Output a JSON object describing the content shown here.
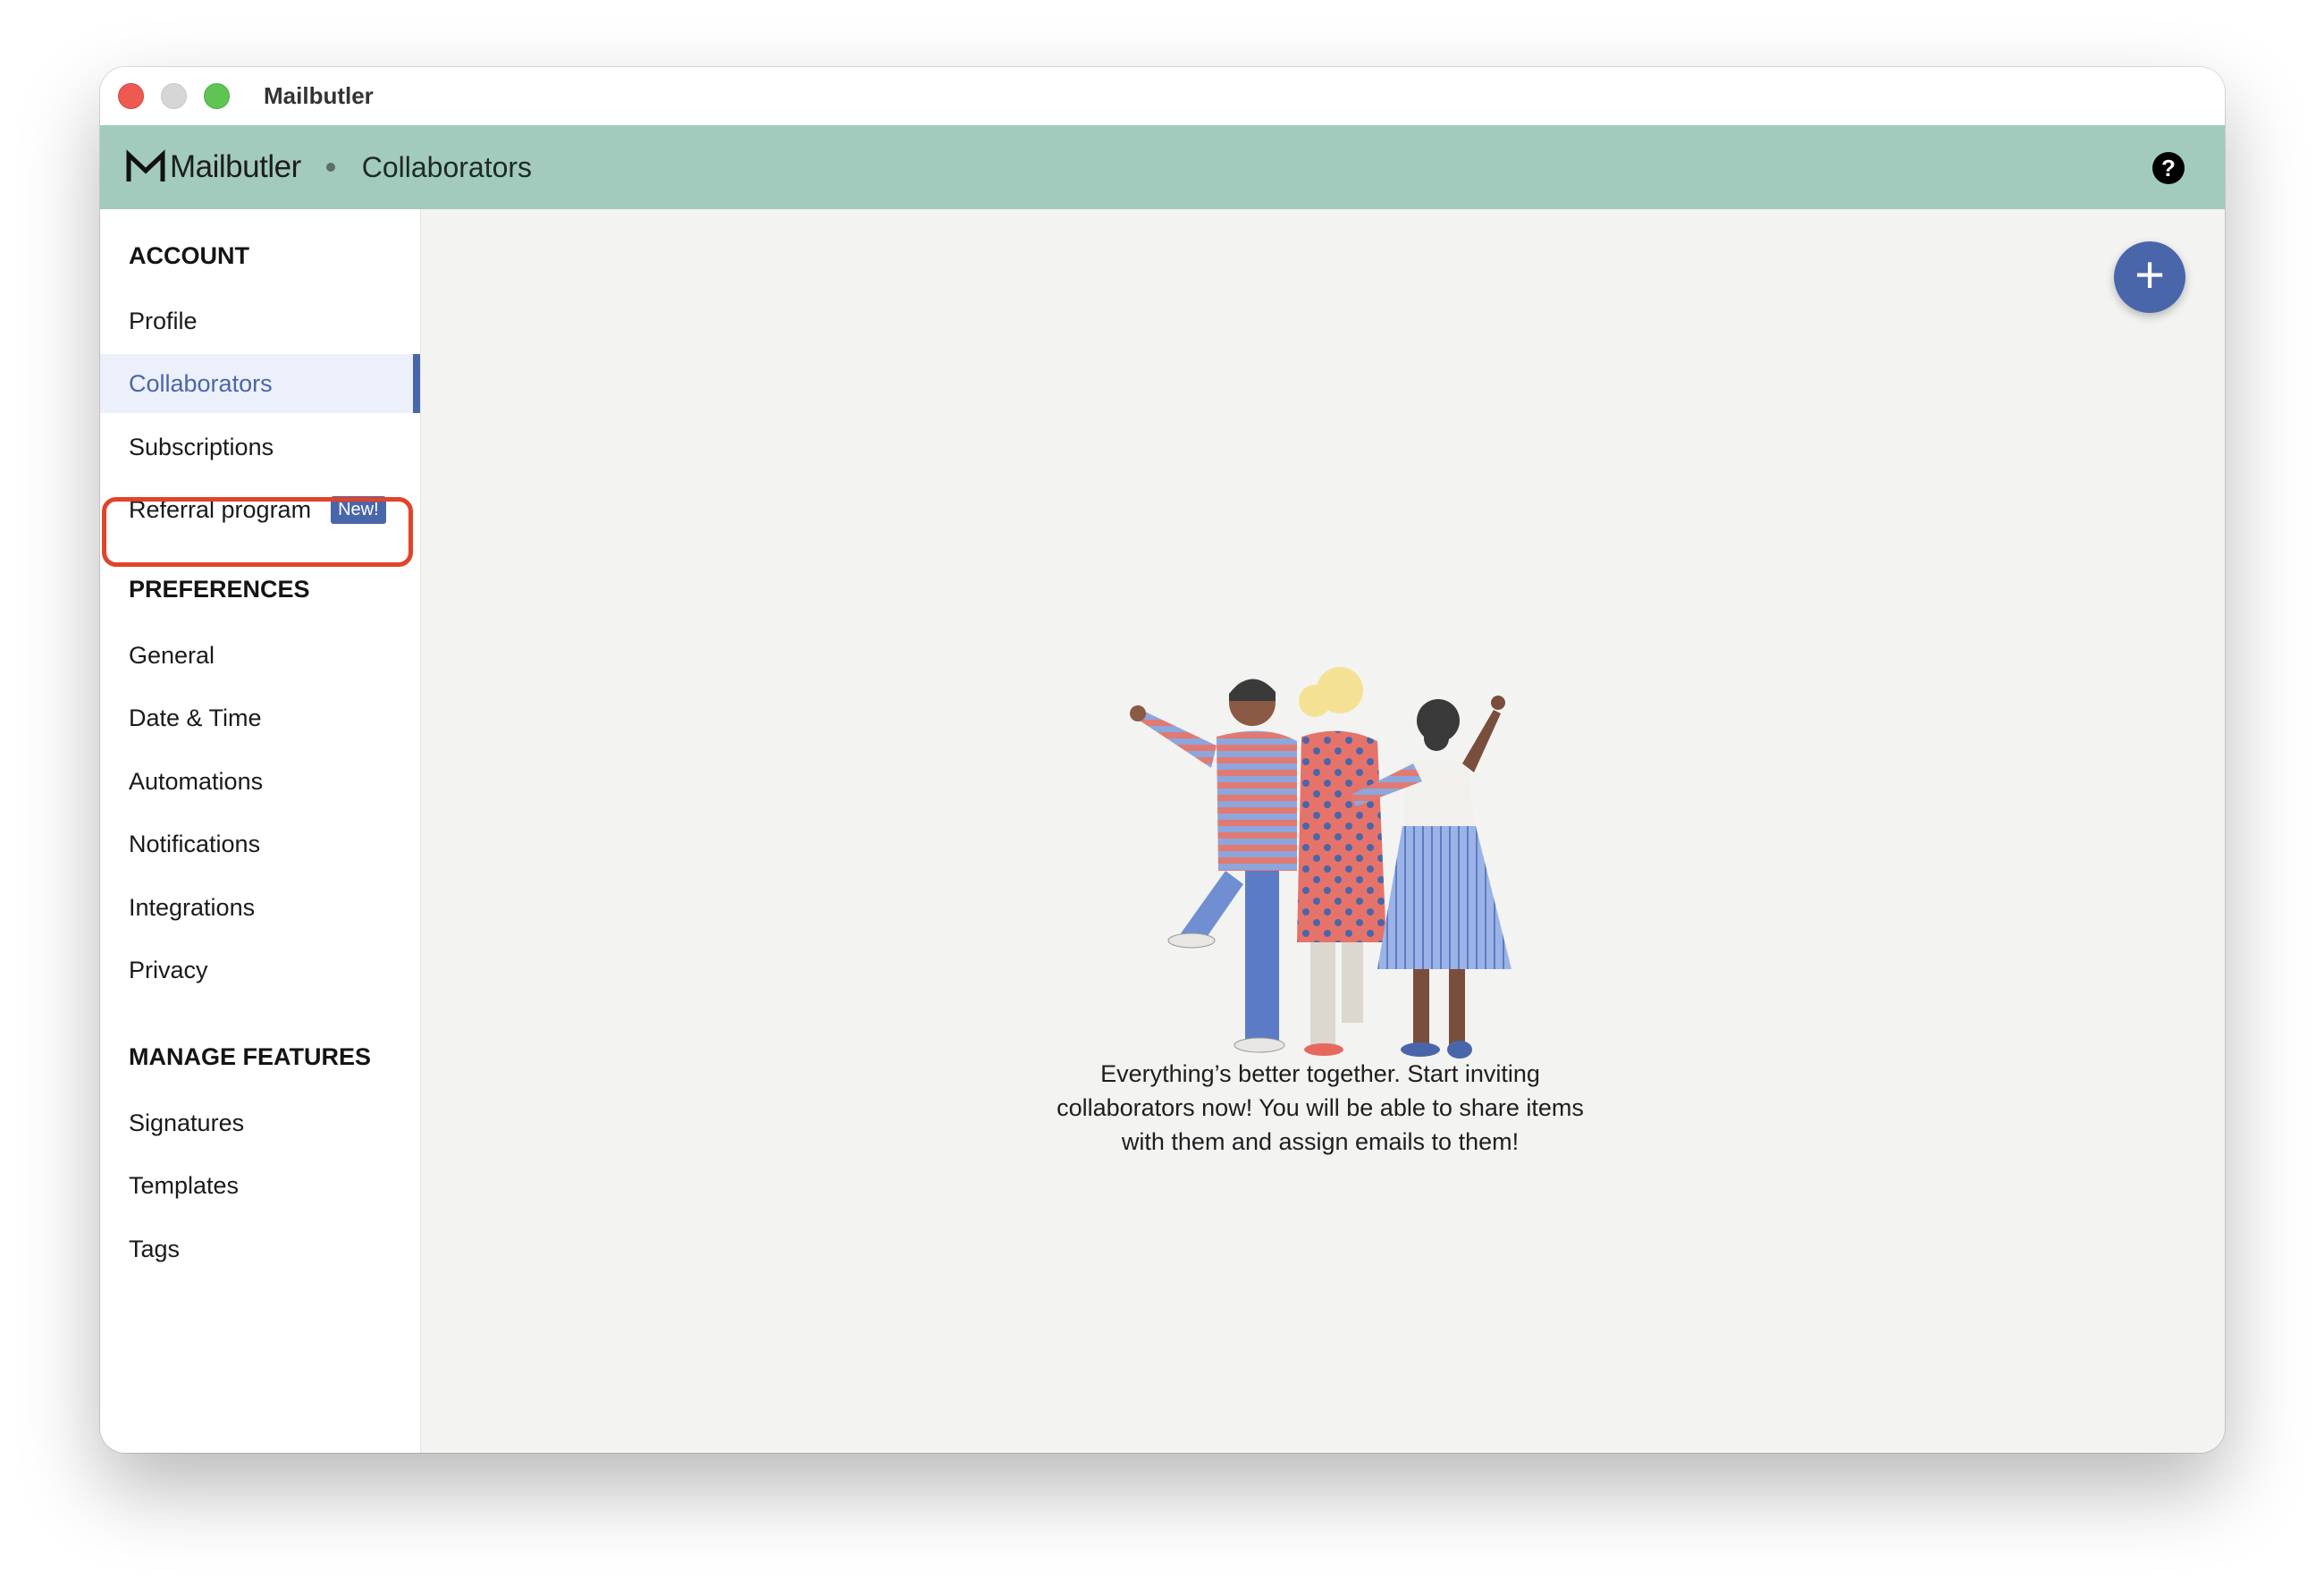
{
  "window": {
    "title": "Mailbutler"
  },
  "header": {
    "logo_text": "Mailbutler",
    "page_title": "Collaborators",
    "help_icon": "question-circle-icon"
  },
  "sidebar": {
    "sections": [
      {
        "title": "ACCOUNT",
        "items": [
          {
            "label": "Profile"
          },
          {
            "label": "Collaborators",
            "active": true
          },
          {
            "label": "Subscriptions"
          },
          {
            "label": "Referral program",
            "badge": "New!"
          }
        ]
      },
      {
        "title": "PREFERENCES",
        "items": [
          {
            "label": "General"
          },
          {
            "label": "Date & Time"
          },
          {
            "label": "Automations"
          },
          {
            "label": "Notifications"
          },
          {
            "label": "Integrations"
          },
          {
            "label": "Privacy"
          }
        ]
      },
      {
        "title": "MANAGE FEATURES",
        "items": [
          {
            "label": "Signatures"
          },
          {
            "label": "Templates"
          },
          {
            "label": "Tags"
          }
        ]
      }
    ]
  },
  "main": {
    "add_button_icon": "plus-icon",
    "add_button_symbol": "+",
    "empty_state_text": "Everything’s better together. Start inviting collaborators now! You will be able to share items with them and assign emails to them!"
  },
  "colors": {
    "header_bg": "#a2cbbd",
    "accent": "#4a66aa",
    "highlight": "#e0442b"
  }
}
